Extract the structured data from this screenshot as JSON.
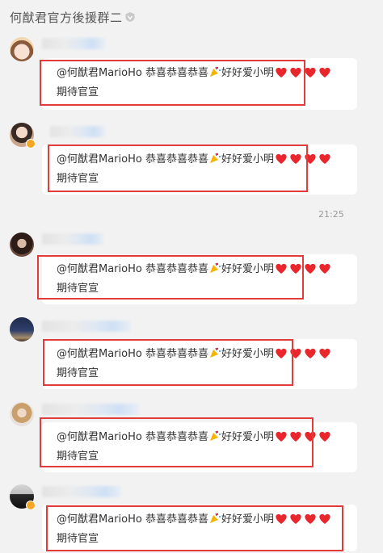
{
  "header": {
    "title": "何猷君官方後援群二",
    "icon": "verified-v-icon"
  },
  "time_separator": "21:25",
  "message_text": {
    "mention": "@何猷君MarioHo",
    "congrats": "恭喜恭喜恭喜",
    "love": "好好爱小明",
    "line2": "期待官宣"
  },
  "messages": [
    {
      "avatar": "avatar-cartoon-girl",
      "badge": false
    },
    {
      "avatar": "avatar-girl-portrait",
      "badge": true
    },
    {
      "avatar": "avatar-dark-hair",
      "badge": false
    },
    {
      "avatar": "avatar-night-sky",
      "badge": false
    },
    {
      "avatar": "avatar-blonde-girl",
      "badge": false
    },
    {
      "avatar": "avatar-dark-figure",
      "badge": true
    }
  ],
  "colors": {
    "highlight_box": "#e23b3b",
    "heart": "#e8262b",
    "badge": "#f5a623"
  }
}
